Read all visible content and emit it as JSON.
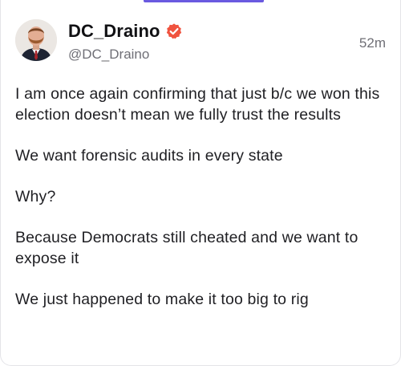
{
  "author": {
    "display_name": "DC_Draino",
    "handle": "@DC_Draino",
    "verified": true,
    "verified_color": "#f0533f"
  },
  "post": {
    "timestamp": "52m",
    "paragraphs": [
      "I am once again confirming that just b/c we won this election doesn’t mean we fully trust the results",
      "We want forensic audits in every state",
      "Why?",
      "Because Democrats still cheated and we want to expose it",
      "We just happened to make it too big to rig"
    ]
  },
  "colors": {
    "accent": "#6a5ae0",
    "text": "#1f1f23",
    "muted": "#6f6f76"
  }
}
